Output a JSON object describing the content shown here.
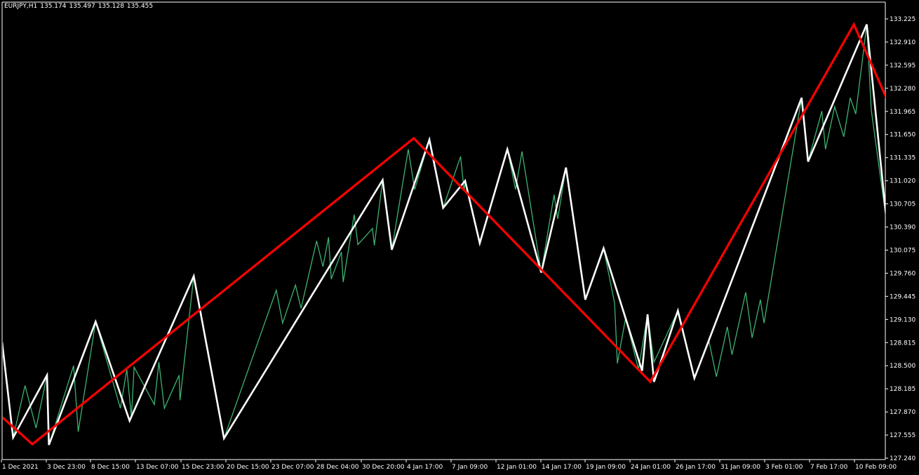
{
  "chart_data": {
    "type": "line",
    "header": {
      "symbol": "EURJPY,H1",
      "open": "135.174",
      "high": "135.497",
      "low": "135.128",
      "close": "135.455"
    },
    "ylim": [
      127.24,
      133.35
    ],
    "price_ticks": [
      "133.225",
      "132.910",
      "132.595",
      "132.280",
      "131.965",
      "131.650",
      "131.335",
      "131.020",
      "130.705",
      "130.390",
      "130.075",
      "129.760",
      "129.445",
      "129.130",
      "128.815",
      "128.500",
      "128.185",
      "127.870",
      "127.555",
      "127.240"
    ],
    "time_ticks": [
      "1 Dec 2021",
      "3 Dec 23:00",
      "8 Dec 15:00",
      "13 Dec 07:00",
      "15 Dec 23:00",
      "20 Dec 15:00",
      "23 Dec 07:00",
      "28 Dec 04:00",
      "30 Dec 20:00",
      "4 Jan 17:00",
      "7 Jan 09:00",
      "12 Jan 01:00",
      "14 Jan 17:00",
      "19 Jan 09:00",
      "24 Jan 01:00",
      "26 Jan 17:00",
      "31 Jan 09:00",
      "3 Feb 01:00",
      "7 Feb 17:00",
      "10 Feb 09:00"
    ],
    "x_range": [
      0,
      100
    ],
    "series": [
      {
        "color": "#3cb371",
        "points": [
          [
            0,
            128.82
          ],
          [
            1.2,
            127.52
          ],
          [
            2.5,
            128.23
          ],
          [
            3.7,
            127.65
          ],
          [
            4.9,
            128.37
          ],
          [
            5.1,
            127.42
          ],
          [
            7.8,
            128.5
          ],
          [
            8.3,
            127.6
          ],
          [
            10.2,
            129.1
          ],
          [
            12.9,
            127.92
          ],
          [
            13.6,
            128.45
          ],
          [
            14.1,
            127.8
          ],
          [
            14.4,
            128.48
          ],
          [
            16.6,
            127.97
          ],
          [
            17.1,
            128.55
          ],
          [
            17.7,
            127.92
          ],
          [
            19.3,
            128.37
          ],
          [
            19.4,
            128.03
          ],
          [
            20.9,
            129.72
          ],
          [
            24.2,
            127.51
          ],
          [
            29.9,
            129.53
          ],
          [
            30.6,
            129.08
          ],
          [
            32.0,
            129.6
          ],
          [
            32.6,
            129.28
          ],
          [
            34.3,
            130.2
          ],
          [
            35.0,
            129.85
          ],
          [
            35.6,
            130.25
          ],
          [
            35.9,
            129.68
          ],
          [
            37.0,
            130.05
          ],
          [
            37.2,
            129.64
          ],
          [
            38.4,
            130.56
          ],
          [
            38.8,
            130.15
          ],
          [
            40.4,
            130.37
          ],
          [
            40.6,
            130.14
          ],
          [
            41.5,
            131.03
          ],
          [
            42.5,
            130.08
          ],
          [
            44.3,
            131.45
          ],
          [
            45.0,
            130.9
          ],
          [
            46.6,
            131.58
          ],
          [
            48.1,
            130.65
          ],
          [
            50.0,
            131.35
          ],
          [
            50.4,
            130.88
          ],
          [
            50.5,
            131.02
          ],
          [
            52.1,
            130.17
          ],
          [
            55.1,
            131.45
          ],
          [
            56.0,
            130.9
          ],
          [
            56.7,
            131.42
          ],
          [
            58.8,
            129.77
          ],
          [
            60.2,
            130.83
          ],
          [
            60.6,
            130.5
          ],
          [
            61.5,
            131.2
          ],
          [
            63.6,
            129.4
          ],
          [
            65.6,
            130.1
          ],
          [
            66.8,
            129.35
          ],
          [
            67.1,
            128.53
          ],
          [
            68.0,
            129.15
          ],
          [
            69.4,
            128.45
          ],
          [
            70.4,
            129.2
          ],
          [
            71.1,
            128.55
          ],
          [
            73.7,
            129.25
          ],
          [
            75.5,
            128.33
          ],
          [
            77.1,
            128.83
          ],
          [
            77.9,
            128.35
          ],
          [
            79.1,
            129.03
          ],
          [
            79.6,
            128.65
          ],
          [
            81.1,
            129.5
          ],
          [
            81.8,
            128.88
          ],
          [
            82.7,
            129.4
          ],
          [
            83.1,
            129.08
          ],
          [
            87.2,
            132.15
          ],
          [
            87.9,
            131.28
          ],
          [
            89.4,
            131.97
          ],
          [
            89.8,
            131.45
          ],
          [
            90.8,
            132.03
          ],
          [
            91.8,
            131.62
          ],
          [
            92.5,
            132.15
          ],
          [
            93.1,
            131.93
          ],
          [
            94.3,
            133.15
          ],
          [
            94.8,
            131.98
          ],
          [
            96.5,
            130.42
          ]
        ]
      },
      {
        "color": "#ffffff",
        "points": [
          [
            0,
            128.82
          ],
          [
            1.2,
            127.52
          ],
          [
            4.9,
            128.37
          ],
          [
            5.1,
            127.42
          ],
          [
            10.2,
            129.1
          ],
          [
            13.9,
            127.75
          ],
          [
            20.9,
            129.72
          ],
          [
            24.2,
            127.51
          ],
          [
            41.5,
            131.03
          ],
          [
            42.5,
            130.08
          ],
          [
            46.6,
            131.58
          ],
          [
            48.1,
            130.65
          ],
          [
            50.5,
            131.02
          ],
          [
            52.1,
            130.17
          ],
          [
            55.1,
            131.45
          ],
          [
            58.8,
            129.77
          ],
          [
            61.5,
            131.2
          ],
          [
            63.6,
            129.4
          ],
          [
            65.6,
            130.1
          ],
          [
            69.8,
            128.43
          ],
          [
            70.4,
            129.2
          ],
          [
            71.1,
            128.28
          ],
          [
            73.7,
            129.25
          ],
          [
            75.5,
            128.33
          ],
          [
            87.2,
            132.15
          ],
          [
            87.9,
            131.28
          ],
          [
            94.3,
            133.15
          ],
          [
            96.5,
            130.42
          ]
        ]
      },
      {
        "color": "#ff0000",
        "points": [
          [
            0,
            127.8
          ],
          [
            3.3,
            127.43
          ],
          [
            44.9,
            131.6
          ],
          [
            70.7,
            128.28
          ],
          [
            92.9,
            133.15
          ],
          [
            97.0,
            131.99
          ]
        ]
      }
    ]
  }
}
